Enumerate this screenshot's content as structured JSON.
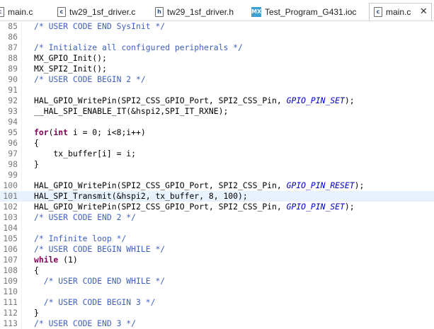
{
  "tabs": [
    {
      "label": "main.c",
      "icon": "c-file-icon",
      "active": false
    },
    {
      "label": "tw29_1sf_driver.c",
      "icon": "c-file-icon",
      "active": false
    },
    {
      "label": "tw29_1sf_driver.h",
      "icon": "h-file-icon",
      "active": false
    },
    {
      "label": "Test_Program_G431.ioc",
      "icon": "mx-cube-icon",
      "active": false
    },
    {
      "label": "main.c",
      "icon": "c-file-icon",
      "active": true
    }
  ],
  "icon_glyphs": {
    "c": "c",
    "h": "h",
    "mx": "MX",
    "close": "✕"
  },
  "lines": [
    {
      "num": "85",
      "tokens": [
        {
          "t": "  /* USER CODE END SysInit */",
          "c": "comment"
        }
      ]
    },
    {
      "num": "86",
      "tokens": []
    },
    {
      "num": "87",
      "tokens": [
        {
          "t": "  /* Initialize all configured peripherals */",
          "c": "comment"
        }
      ]
    },
    {
      "num": "88",
      "tokens": [
        {
          "t": "  MX_GPIO_Init();",
          "c": "plain"
        }
      ]
    },
    {
      "num": "89",
      "tokens": [
        {
          "t": "  MX_SPI2_Init();",
          "c": "plain"
        }
      ]
    },
    {
      "num": "90",
      "tokens": [
        {
          "t": "  /* USER CODE BEGIN 2 */",
          "c": "comment"
        }
      ]
    },
    {
      "num": "91",
      "tokens": []
    },
    {
      "num": "92",
      "tokens": [
        {
          "t": "  HAL_GPIO_WritePin(SPI2_CSS_GPIO_Port, SPI2_CSS_Pin, ",
          "c": "plain"
        },
        {
          "t": "GPIO_PIN_SET",
          "c": "macro"
        },
        {
          "t": ");",
          "c": "plain"
        }
      ]
    },
    {
      "num": "93",
      "tokens": [
        {
          "t": "  __HAL_SPI_ENABLE_IT(&hspi2,SPI_IT_RXNE);",
          "c": "plain"
        }
      ]
    },
    {
      "num": "94",
      "tokens": []
    },
    {
      "num": "95",
      "tokens": [
        {
          "t": "  ",
          "c": "plain"
        },
        {
          "t": "for",
          "c": "keyword"
        },
        {
          "t": "(",
          "c": "plain"
        },
        {
          "t": "int",
          "c": "keyword"
        },
        {
          "t": " i = 0; i<8;i++)",
          "c": "plain"
        }
      ]
    },
    {
      "num": "96",
      "tokens": [
        {
          "t": "  {",
          "c": "plain"
        }
      ]
    },
    {
      "num": "97",
      "tokens": [
        {
          "t": "      tx_buffer[i] = i;",
          "c": "plain"
        }
      ]
    },
    {
      "num": "98",
      "tokens": [
        {
          "t": "  }",
          "c": "plain"
        }
      ]
    },
    {
      "num": "99",
      "tokens": []
    },
    {
      "num": "100",
      "tokens": [
        {
          "t": "  HAL_GPIO_WritePin(SPI2_CSS_GPIO_Port, SPI2_CSS_Pin, ",
          "c": "plain"
        },
        {
          "t": "GPIO_PIN_RESET",
          "c": "macro"
        },
        {
          "t": ");",
          "c": "plain"
        }
      ]
    },
    {
      "num": "101",
      "current": true,
      "tokens": [
        {
          "t": "  HAL_SPI_Transmit(&hspi2, tx_buffer, 8, 100);",
          "c": "plain"
        }
      ]
    },
    {
      "num": "102",
      "tokens": [
        {
          "t": "  HAL_GPIO_WritePin(SPI2_CSS_GPIO_Port, SPI2_CSS_Pin, ",
          "c": "plain"
        },
        {
          "t": "GPIO_PIN_SET",
          "c": "macro"
        },
        {
          "t": ");",
          "c": "plain"
        }
      ]
    },
    {
      "num": "103",
      "tokens": [
        {
          "t": "  /* USER CODE END 2 */",
          "c": "comment"
        }
      ]
    },
    {
      "num": "104",
      "tokens": []
    },
    {
      "num": "105",
      "tokens": [
        {
          "t": "  /* Infinite loop */",
          "c": "comment"
        }
      ]
    },
    {
      "num": "106",
      "tokens": [
        {
          "t": "  /* USER CODE BEGIN WHILE */",
          "c": "comment"
        }
      ]
    },
    {
      "num": "107",
      "tokens": [
        {
          "t": "  ",
          "c": "plain"
        },
        {
          "t": "while",
          "c": "keyword"
        },
        {
          "t": " (1)",
          "c": "plain"
        }
      ]
    },
    {
      "num": "108",
      "tokens": [
        {
          "t": "  {",
          "c": "plain"
        }
      ]
    },
    {
      "num": "109",
      "tokens": [
        {
          "t": "    /* USER CODE END WHILE */",
          "c": "comment"
        }
      ]
    },
    {
      "num": "110",
      "tokens": []
    },
    {
      "num": "111",
      "tokens": [
        {
          "t": "    /* USER CODE BEGIN 3 */",
          "c": "comment"
        }
      ]
    },
    {
      "num": "112",
      "tokens": [
        {
          "t": "  }",
          "c": "plain"
        }
      ]
    },
    {
      "num": "113",
      "tokens": [
        {
          "t": "  /* USER CODE END 3 */",
          "c": "comment"
        }
      ]
    }
  ]
}
